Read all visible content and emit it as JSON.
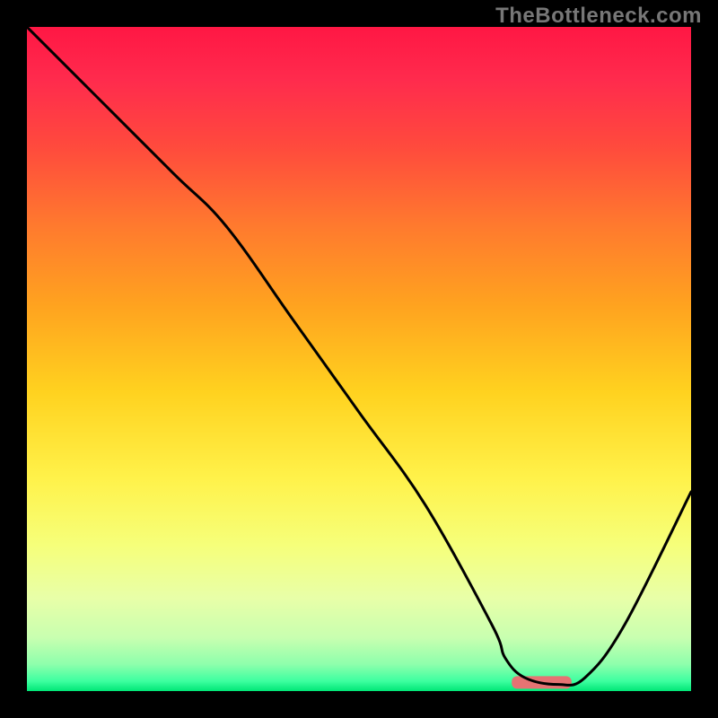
{
  "watermark": "TheBottleneck.com",
  "chart_data": {
    "type": "line",
    "title": "",
    "xlabel": "",
    "ylabel": "",
    "xlim": [
      0,
      100
    ],
    "ylim": [
      0,
      100
    ],
    "grid": false,
    "series": [
      {
        "name": "curve",
        "x": [
          0,
          10,
          22,
          30,
          40,
          50,
          60,
          70,
          72,
          75,
          80,
          84,
          90,
          100
        ],
        "y": [
          100,
          90,
          78,
          70,
          56,
          42,
          28,
          10,
          5,
          2,
          1,
          2,
          10,
          30
        ]
      }
    ],
    "marker": {
      "x_start": 73,
      "x_end": 82,
      "y": 1.3,
      "color": "#e57373"
    },
    "gradient_stops": [
      {
        "offset": 0.0,
        "color": "#ff1744"
      },
      {
        "offset": 0.08,
        "color": "#ff2b4d"
      },
      {
        "offset": 0.18,
        "color": "#ff4a3d"
      },
      {
        "offset": 0.3,
        "color": "#ff7a2e"
      },
      {
        "offset": 0.42,
        "color": "#ffa31f"
      },
      {
        "offset": 0.55,
        "color": "#ffd21f"
      },
      {
        "offset": 0.68,
        "color": "#fff24a"
      },
      {
        "offset": 0.78,
        "color": "#f6ff7a"
      },
      {
        "offset": 0.86,
        "color": "#e8ffa8"
      },
      {
        "offset": 0.92,
        "color": "#c8ffb0"
      },
      {
        "offset": 0.96,
        "color": "#8dffac"
      },
      {
        "offset": 0.985,
        "color": "#3dffa0"
      },
      {
        "offset": 1.0,
        "color": "#00e676"
      }
    ]
  }
}
